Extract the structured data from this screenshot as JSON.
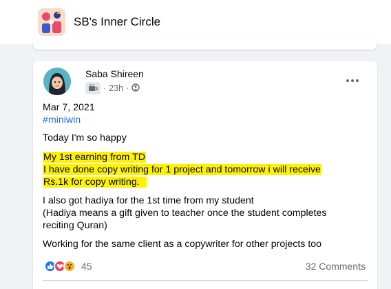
{
  "group": {
    "name": "SB's Inner Circle",
    "avatar_icon": "group-illustration-icon"
  },
  "post": {
    "author": "Saba Shireen",
    "author_avatar_icon": "hijab-avatar-icon",
    "badge_icon": "coffee-cup-icon",
    "time": "23h",
    "separator": "·",
    "privacy_icon": "globe-icon",
    "more_icon": "more-options-icon",
    "date_line": "Mar 7, 2021",
    "hashtag": "#miniwin",
    "line_happy": "Today I'm so happy",
    "highlight_lines": [
      "My 1st earning from TD",
      "I have done copy writing for 1 project and tomorrow i will receive",
      "Rs.1k for copy writing."
    ],
    "hadiya_lines": [
      "I also got hadiya for the 1st time from my student",
      "(Hadiya means a gift given to teacher once the student completes",
      "reciting Quran)"
    ],
    "closing_line": "Working for the same client as a copywriter  for other projects too",
    "reactions": {
      "icons": [
        "like-icon",
        "love-icon",
        "wow-icon"
      ],
      "count": "45"
    },
    "comments": "32 Comments"
  },
  "colors": {
    "highlight": "#fff200",
    "link": "#216fdb",
    "secondary_text": "#65676b",
    "like_blue": "#1877f2",
    "love_red": "#f33e58",
    "wow_yellow": "#f7b125"
  }
}
